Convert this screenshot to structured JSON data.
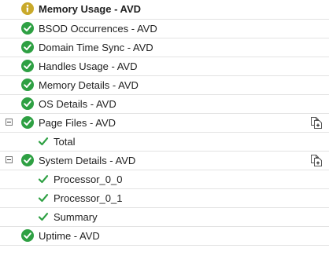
{
  "colors": {
    "ok_green": "#2ea043",
    "info_yellow": "#c9a92a",
    "row_border": "#e3e3e3"
  },
  "tree": {
    "rows": [
      {
        "label": "Memory Usage - AVD",
        "status": "info-icon",
        "level": 0,
        "bold": true
      },
      {
        "label": "BSOD Occurrences - AVD",
        "status": "check-circle-icon",
        "level": 0
      },
      {
        "label": "Domain Time Sync - AVD",
        "status": "check-circle-icon",
        "level": 0
      },
      {
        "label": "Handles Usage - AVD",
        "status": "check-circle-icon",
        "level": 0
      },
      {
        "label": "Memory Details - AVD",
        "status": "check-circle-icon",
        "level": 0
      },
      {
        "label": "OS Details - AVD",
        "status": "check-circle-icon",
        "level": 0
      },
      {
        "label": "Page Files - AVD",
        "status": "check-circle-icon",
        "level": 0,
        "expanded": true
      },
      {
        "label": "Total",
        "status": "check-icon",
        "level": 1
      },
      {
        "label": "System Details - AVD",
        "status": "check-circle-icon",
        "level": 0,
        "expanded": true
      },
      {
        "label": "Processor_0_0",
        "status": "check-icon",
        "level": 1
      },
      {
        "label": "Processor_0_1",
        "status": "check-icon",
        "level": 1
      },
      {
        "label": "Summary",
        "status": "check-icon",
        "level": 1
      },
      {
        "label": "Uptime - AVD",
        "status": "check-circle-icon",
        "level": 0
      }
    ]
  }
}
